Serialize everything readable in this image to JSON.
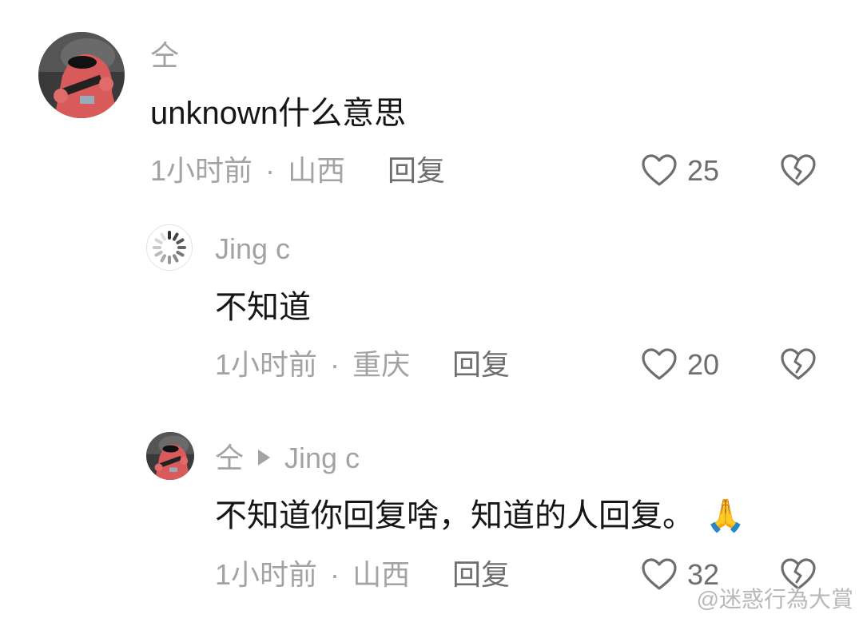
{
  "comments": [
    {
      "username": "仝",
      "text": "unknown什么意思",
      "time": "1小时前",
      "location": "山西",
      "reply_label": "回复",
      "likes": "25",
      "avatar": "patrick-avatar"
    },
    {
      "username": "Jing c",
      "text": "不知道",
      "time": "1小时前",
      "location": "重庆",
      "reply_label": "回复",
      "likes": "20",
      "avatar": "loading-spinner-avatar"
    },
    {
      "username": "仝",
      "reply_to": "Jing c",
      "text": "不知道你回复啥，知道的人回复。",
      "emoji": "🙏",
      "time": "1小时前",
      "location": "山西",
      "reply_label": "回复",
      "likes": "32",
      "avatar": "patrick-avatar"
    }
  ],
  "meta_separator": "·",
  "watermark": "@迷惑行為大賞",
  "colors": {
    "text": "#161616",
    "secondary": "#a3a3a3",
    "action": "#6e6e6e",
    "background": "#ffffff"
  }
}
